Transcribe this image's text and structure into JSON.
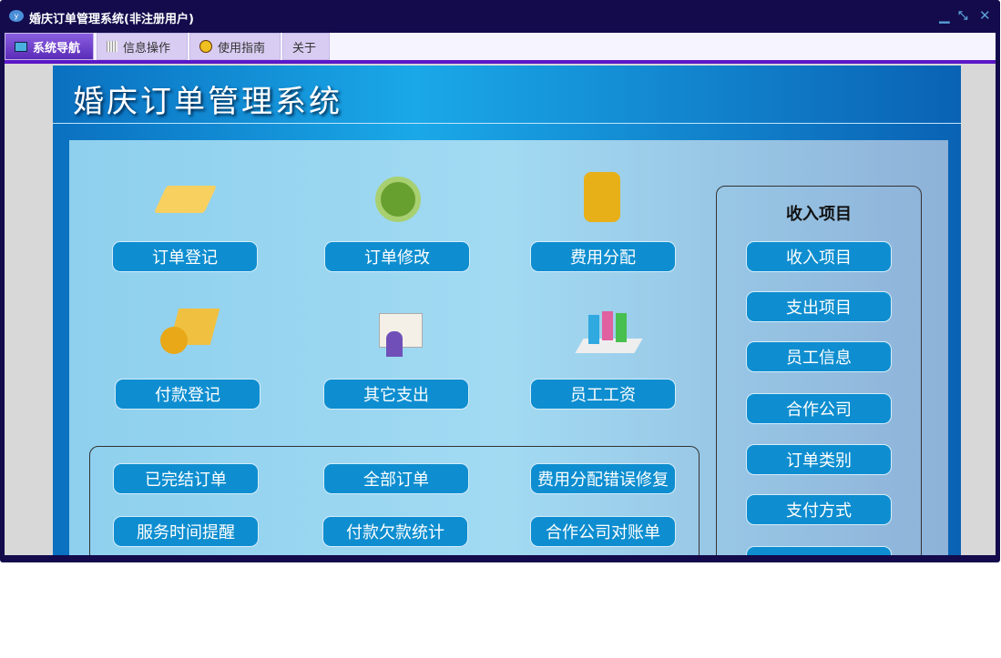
{
  "window": {
    "title": "婚庆订单管理系统(非注册用户)",
    "controls": [
      "minimize",
      "restore",
      "close"
    ]
  },
  "tabs": [
    {
      "label": "系统导航",
      "icon": "monitor-icon"
    },
    {
      "label": "信息操作",
      "icon": "grid-icon"
    },
    {
      "label": "使用指南",
      "icon": "help-icon"
    },
    {
      "label": "关于"
    }
  ],
  "header": {
    "title": "婚庆订单管理系统"
  },
  "main_buttons": [
    "订单登记",
    "订单修改",
    "费用分配",
    "付款登记",
    "其它支出",
    "员工工资"
  ],
  "bottom_buttons": [
    "已完结订单",
    "全部订单",
    "费用分配错误修复",
    "服务时间提醒",
    "付款欠款统计",
    "合作公司对账单"
  ],
  "side": {
    "title": "收入项目",
    "buttons": [
      "收入项目",
      "支出项目",
      "员工信息",
      "合作公司",
      "订单类别",
      "支付方式"
    ]
  }
}
